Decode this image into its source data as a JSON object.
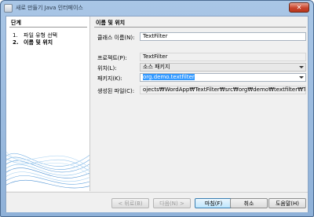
{
  "window": {
    "title": "새로 만들기 Java 인터페이스",
    "close_glyph": "✕"
  },
  "steps": {
    "title": "단계",
    "items": [
      {
        "num": "1.",
        "label": "파일 유형 선택"
      },
      {
        "num": "2.",
        "label": "이름 및 위치"
      }
    ]
  },
  "form": {
    "title": "이름 및 위치",
    "class_name_label": "클래스 이름(N):",
    "class_name_value": "TextFilter",
    "project_label": "프로젝트(P):",
    "project_value": "TextFilter",
    "location_label": "위치(L):",
    "location_value": "소스 패키지",
    "package_label": "패키지(K):",
    "package_value": "org.demo.textfilter",
    "created_file_label": "생성된 파일(C):",
    "created_file_value": "ojects₩WordApp₩TextFilter₩src₩org₩demo₩textfilter₩TextFilter.java"
  },
  "buttons": {
    "back": "< 뒤로(B)",
    "next": "다음(N) >",
    "finish": "마침(F)",
    "cancel": "취소",
    "help": "도움말(H)"
  }
}
